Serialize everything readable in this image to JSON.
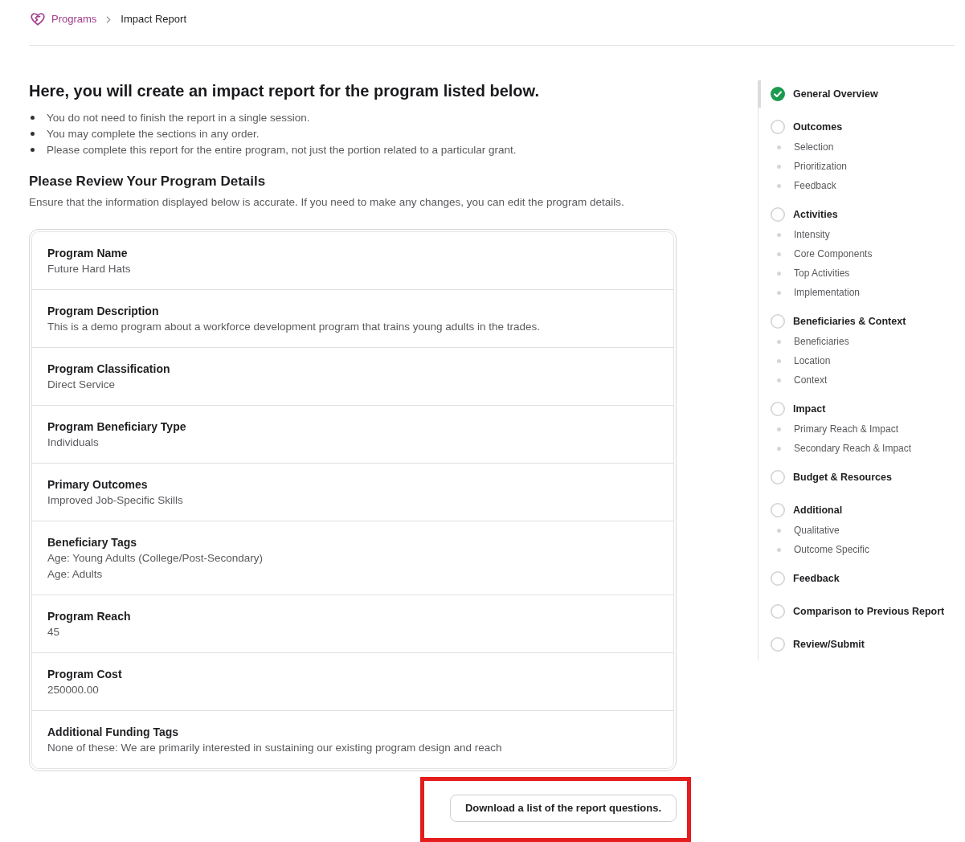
{
  "breadcrumb": {
    "items": [
      {
        "label": "Programs",
        "kind": "link"
      },
      {
        "label": "Impact Report",
        "kind": "current"
      }
    ]
  },
  "intro": {
    "heading": "Here, you will create an impact report for the program listed below.",
    "bullets": [
      "You do not need to finish the report in a single session.",
      "You may complete the sections in any order.",
      "Please complete this report for the entire program, not just the portion related to a particular grant."
    ]
  },
  "review": {
    "heading": "Please Review Your Program Details",
    "description": "Ensure that the information displayed below is accurate. If you need to make any changes, you can edit the program details."
  },
  "details": [
    {
      "label": "Program Name",
      "values": [
        "Future Hard Hats"
      ]
    },
    {
      "label": "Program Description",
      "values": [
        "This is a demo program about a workforce development program that trains young adults in the trades."
      ]
    },
    {
      "label": "Program Classification",
      "values": [
        "Direct Service"
      ]
    },
    {
      "label": "Program Beneficiary Type",
      "values": [
        "Individuals"
      ]
    },
    {
      "label": "Primary Outcomes",
      "values": [
        "Improved Job-Specific Skills"
      ]
    },
    {
      "label": "Beneficiary Tags",
      "values": [
        "Age: Young Adults (College/Post-Secondary)",
        "Age: Adults"
      ]
    },
    {
      "label": "Program Reach",
      "values": [
        "45"
      ]
    },
    {
      "label": "Program Cost",
      "values": [
        "250000.00"
      ]
    },
    {
      "label": "Additional Funding Tags",
      "values": [
        "None of these: We are primarily interested in sustaining our existing program design and reach"
      ]
    }
  ],
  "download_button": {
    "label": "Download a list of the report questions.",
    "highlighted": true
  },
  "steps": [
    {
      "title": "General Overview",
      "completed": true,
      "selected": true
    },
    {
      "title": "Outcomes",
      "completed": false,
      "selected": false,
      "children": [
        {
          "label": "Selection"
        },
        {
          "label": "Prioritization"
        },
        {
          "label": "Feedback"
        }
      ]
    },
    {
      "title": "Activities",
      "completed": false,
      "selected": false,
      "children": [
        {
          "label": "Intensity"
        },
        {
          "label": "Core Components"
        },
        {
          "label": "Top Activities"
        },
        {
          "label": "Implementation"
        }
      ]
    },
    {
      "title": "Beneficiaries & Context",
      "completed": false,
      "selected": false,
      "children": [
        {
          "label": "Beneficiaries"
        },
        {
          "label": "Location"
        },
        {
          "label": "Context"
        }
      ]
    },
    {
      "title": "Impact",
      "completed": false,
      "selected": false,
      "children": [
        {
          "label": "Primary Reach & Impact"
        },
        {
          "label": "Secondary Reach & Impact"
        }
      ]
    },
    {
      "title": "Budget & Resources",
      "completed": false,
      "selected": false
    },
    {
      "title": "Additional",
      "completed": false,
      "selected": false,
      "children": [
        {
          "label": "Qualitative"
        },
        {
          "label": "Outcome Specific"
        }
      ]
    },
    {
      "title": "Feedback",
      "completed": false,
      "selected": false
    },
    {
      "title": "Comparison to Previous Report",
      "completed": false,
      "selected": false
    },
    {
      "title": "Review/Submit",
      "completed": false,
      "selected": false
    }
  ]
}
